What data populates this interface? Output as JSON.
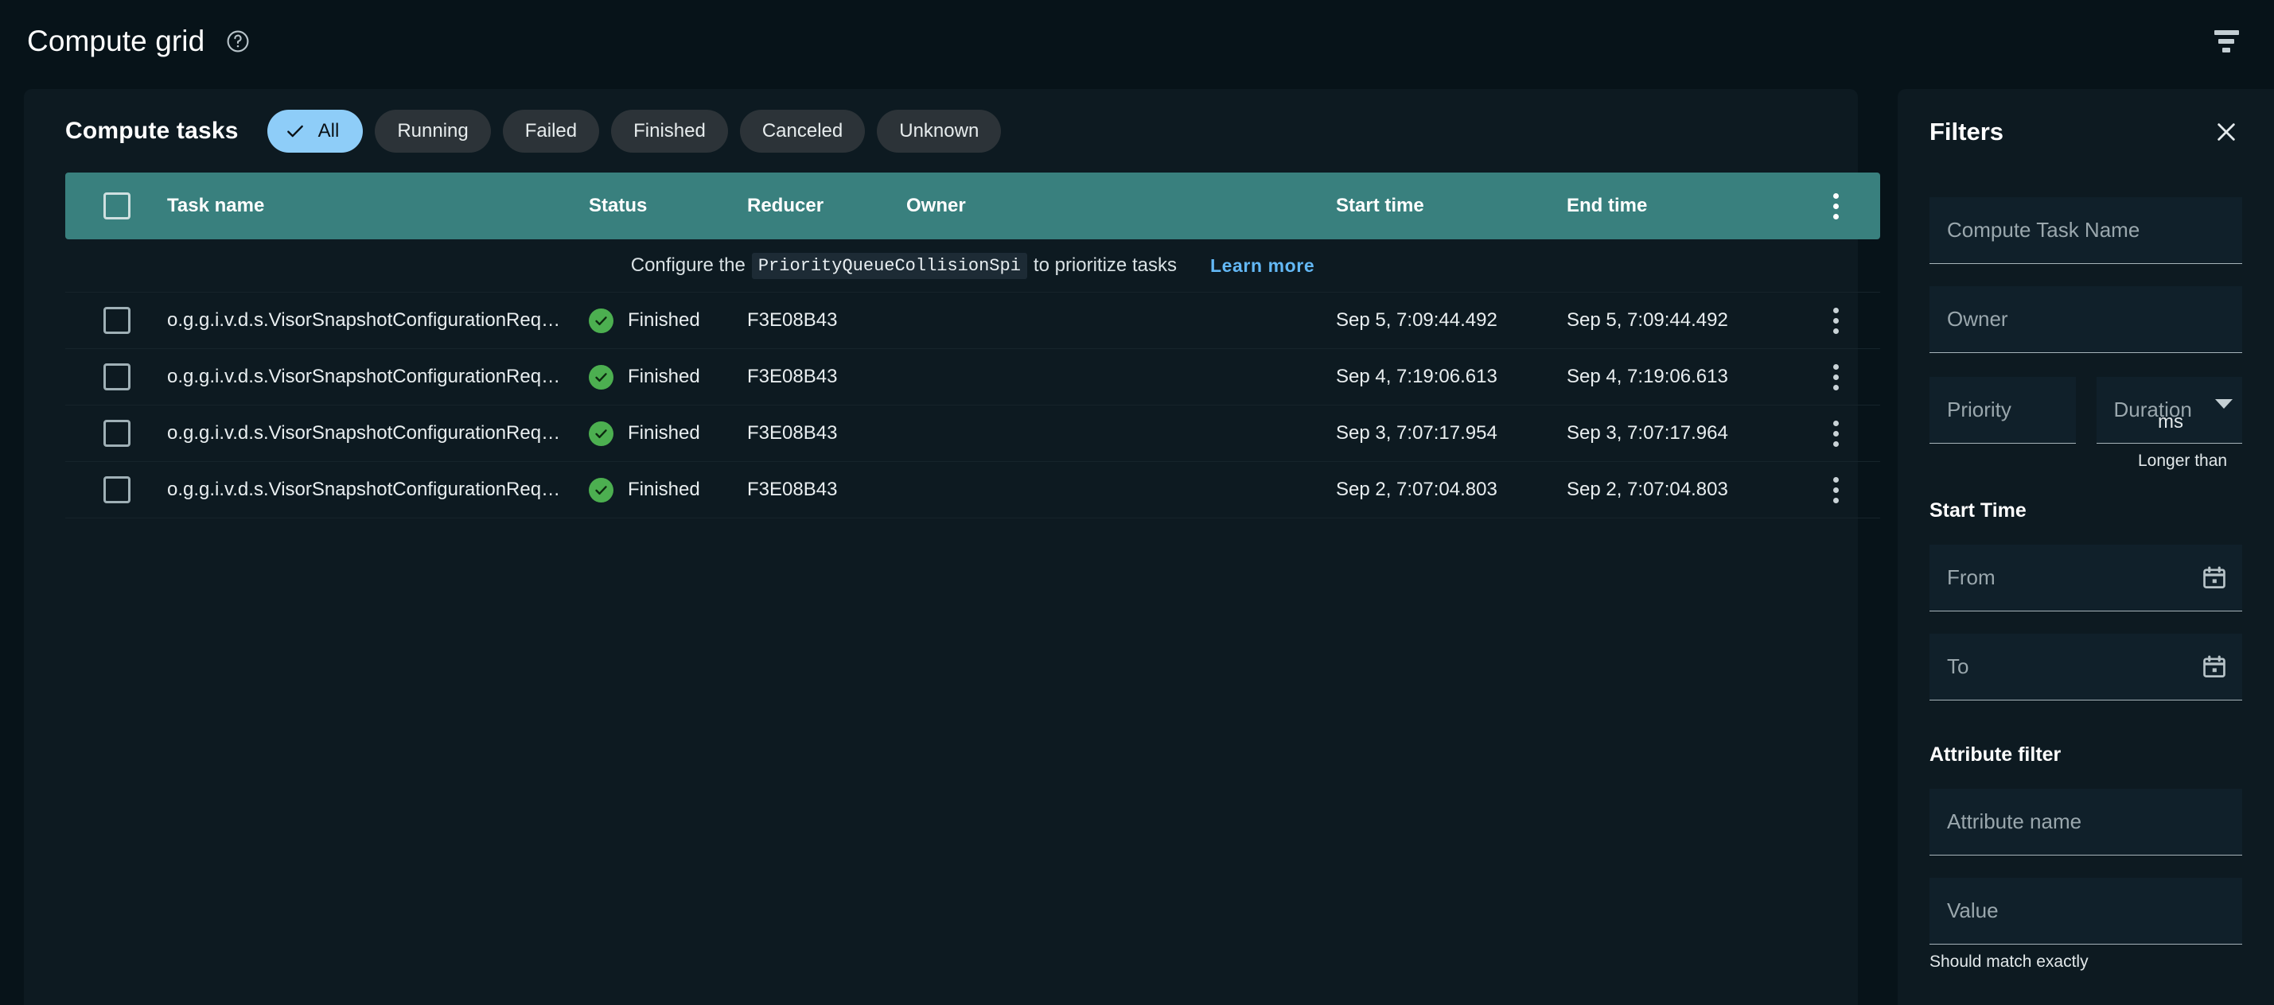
{
  "topbar": {
    "title": "Compute grid",
    "help_icon": "help-circle-icon",
    "filter_icon": "funnel-filter-icon"
  },
  "card": {
    "title": "Compute tasks",
    "chips": [
      {
        "label": "All",
        "selected": true
      },
      {
        "label": "Running",
        "selected": false
      },
      {
        "label": "Failed",
        "selected": false
      },
      {
        "label": "Finished",
        "selected": false
      },
      {
        "label": "Canceled",
        "selected": false
      },
      {
        "label": "Unknown",
        "selected": false
      }
    ],
    "columns": {
      "task_name": "Task name",
      "status": "Status",
      "reducer": "Reducer",
      "owner": "Owner",
      "start_time": "Start time",
      "end_time": "End time"
    },
    "notice": {
      "prefix": "Configure the",
      "code": "PriorityQueueCollisionSpi",
      "suffix": "to prioritize tasks",
      "link": "Learn more"
    },
    "rows": [
      {
        "task_name": "o.g.g.i.v.d.s.VisorSnapshotConfigurationReq…",
        "status": "Finished",
        "reducer": "F3E08B43",
        "owner": "",
        "start_time": "Sep 5, 7:09:44.492",
        "end_time": "Sep 5, 7:09:44.492"
      },
      {
        "task_name": "o.g.g.i.v.d.s.VisorSnapshotConfigurationReq…",
        "status": "Finished",
        "reducer": "F3E08B43",
        "owner": "",
        "start_time": "Sep 4, 7:19:06.613",
        "end_time": "Sep 4, 7:19:06.613"
      },
      {
        "task_name": "o.g.g.i.v.d.s.VisorSnapshotConfigurationReq…",
        "status": "Finished",
        "reducer": "F3E08B43",
        "owner": "",
        "start_time": "Sep 3, 7:07:17.954",
        "end_time": "Sep 3, 7:07:17.964"
      },
      {
        "task_name": "o.g.g.i.v.d.s.VisorSnapshotConfigurationReq…",
        "status": "Finished",
        "reducer": "F3E08B43",
        "owner": "",
        "start_time": "Sep 2, 7:07:04.803",
        "end_time": "Sep 2, 7:07:04.803"
      }
    ]
  },
  "filters": {
    "title": "Filters",
    "close_icon": "close-x-icon",
    "task_name": {
      "placeholder": "Compute Task Name",
      "value": ""
    },
    "owner": {
      "placeholder": "Owner",
      "value": ""
    },
    "priority": {
      "placeholder": "Priority",
      "value": ""
    },
    "duration": {
      "placeholder": "Duration",
      "value": "",
      "unit": "ms",
      "hint": "Longer than"
    },
    "start_time_label": "Start Time",
    "from": {
      "placeholder": "From",
      "value": "",
      "icon": "calendar-icon"
    },
    "to": {
      "placeholder": "To",
      "value": "",
      "icon": "calendar-icon"
    },
    "attribute_filter_label": "Attribute filter",
    "attribute_name": {
      "placeholder": "Attribute name",
      "value": ""
    },
    "attribute_value": {
      "placeholder": "Value",
      "value": "",
      "hint": "Should match exactly"
    }
  },
  "colors": {
    "page_bg": "#071319",
    "card_bg": "#0d1a21",
    "table_header": "#39807e",
    "chip_selected": "#8ecdf8",
    "status_ok": "#4caf50",
    "link": "#63b8f5"
  }
}
